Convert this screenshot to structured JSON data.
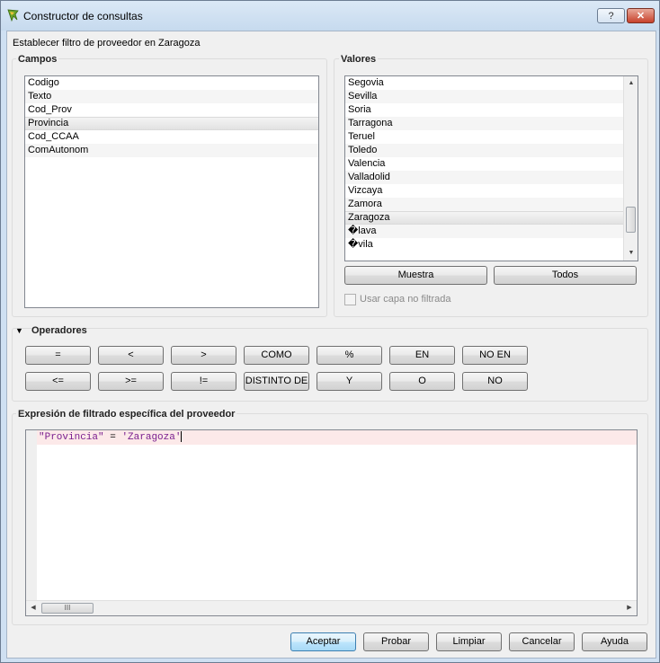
{
  "window": {
    "title": "Constructor de consultas",
    "help_label": "?",
    "close_label": "✕"
  },
  "description": "Establecer filtro de proveedor en Zaragoza",
  "campos": {
    "title": "Campos",
    "items": [
      {
        "label": "Codigo",
        "selected": false
      },
      {
        "label": "Texto",
        "selected": false
      },
      {
        "label": "Cod_Prov",
        "selected": false
      },
      {
        "label": "Provincia",
        "selected": true
      },
      {
        "label": "Cod_CCAA",
        "selected": false
      },
      {
        "label": "ComAutonom",
        "selected": false
      }
    ]
  },
  "valores": {
    "title": "Valores",
    "items": [
      {
        "label": "Segovia",
        "selected": false
      },
      {
        "label": "Sevilla",
        "selected": false
      },
      {
        "label": "Soria",
        "selected": false
      },
      {
        "label": "Tarragona",
        "selected": false
      },
      {
        "label": "Teruel",
        "selected": false
      },
      {
        "label": "Toledo",
        "selected": false
      },
      {
        "label": "Valencia",
        "selected": false
      },
      {
        "label": "Valladolid",
        "selected": false
      },
      {
        "label": "Vizcaya",
        "selected": false
      },
      {
        "label": "Zamora",
        "selected": false
      },
      {
        "label": "Zaragoza",
        "selected": true
      },
      {
        "label": "�lava",
        "selected": false
      },
      {
        "label": "�vila",
        "selected": false
      }
    ],
    "muestra_label": "Muestra",
    "todos_label": "Todos",
    "checkbox_label": "Usar capa no filtrada"
  },
  "operadores": {
    "title": "Operadores",
    "row1": [
      "=",
      "<",
      ">",
      "COMO",
      "%",
      "EN",
      "NO EN"
    ],
    "row2": [
      "<=",
      ">=",
      "!=",
      "DISTINTO DE",
      "Y",
      "O",
      "NO"
    ]
  },
  "expression": {
    "title": "Expresión de filtrado específica del proveedor",
    "field": "\"Provincia\"",
    "operator": " = ",
    "value": "'Zaragoza'",
    "hscroll_label": "III"
  },
  "buttons": {
    "aceptar": "Aceptar",
    "probar": "Probar",
    "limpiar": "Limpiar",
    "cancelar": "Cancelar",
    "ayuda": "Ayuda"
  }
}
